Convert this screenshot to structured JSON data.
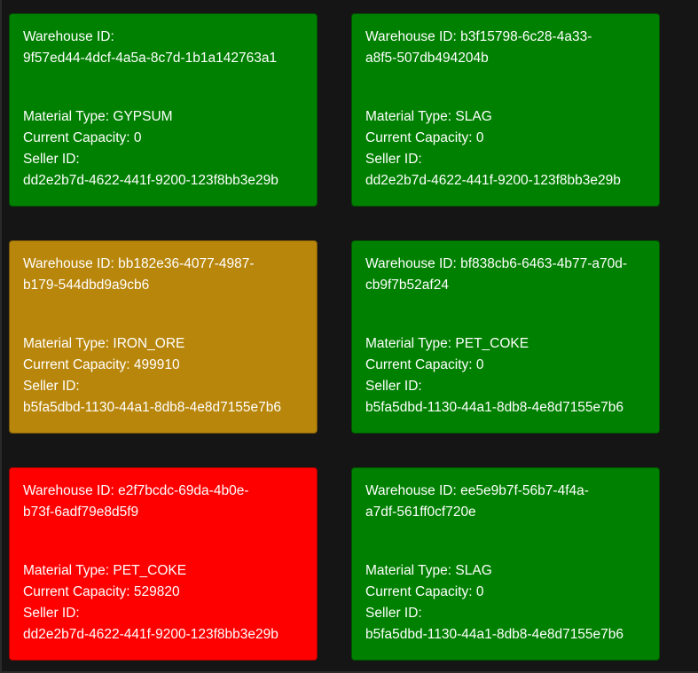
{
  "colors": {
    "ok": "#008000",
    "warn": "#b8860b",
    "alert": "#ff0000",
    "background": "#151515"
  },
  "labels": {
    "warehouse_id": "Warehouse ID:",
    "material_type": "Material Type:",
    "current_capacity": "Current Capacity:",
    "seller_id": "Seller ID:"
  },
  "warehouses": [
    {
      "warehouse_id": "9f57ed44-4dcf-4a5a-8c7d-1b1a142763a1",
      "material_type": "GYPSUM",
      "current_capacity": "0",
      "seller_id": "dd2e2b7d-4622-441f-9200-123f8bb3e29b",
      "status_color": "#008000"
    },
    {
      "warehouse_id": "b3f15798-6c28-4a33-a8f5-507db494204b",
      "material_type": "SLAG",
      "current_capacity": "0",
      "seller_id": "dd2e2b7d-4622-441f-9200-123f8bb3e29b",
      "status_color": "#008000"
    },
    {
      "warehouse_id": "bb182e36-4077-4987-b179-544dbd9a9cb6",
      "material_type": "IRON_ORE",
      "current_capacity": "499910",
      "seller_id": "b5fa5dbd-1130-44a1-8db8-4e8d7155e7b6",
      "status_color": "#b8860b"
    },
    {
      "warehouse_id": "bf838cb6-6463-4b77-a70d-cb9f7b52af24",
      "material_type": "PET_COKE",
      "current_capacity": "0",
      "seller_id": "b5fa5dbd-1130-44a1-8db8-4e8d7155e7b6",
      "status_color": "#008000"
    },
    {
      "warehouse_id": "e2f7bcdc-69da-4b0e-b73f-6adf79e8d5f9",
      "material_type": "PET_COKE",
      "current_capacity": "529820",
      "seller_id": "dd2e2b7d-4622-441f-9200-123f8bb3e29b",
      "status_color": "#ff0000"
    },
    {
      "warehouse_id": "ee5e9b7f-56b7-4f4a-a7df-561ff0cf720e",
      "material_type": "SLAG",
      "current_capacity": "0",
      "seller_id": "b5fa5dbd-1130-44a1-8db8-4e8d7155e7b6",
      "status_color": "#008000"
    }
  ]
}
